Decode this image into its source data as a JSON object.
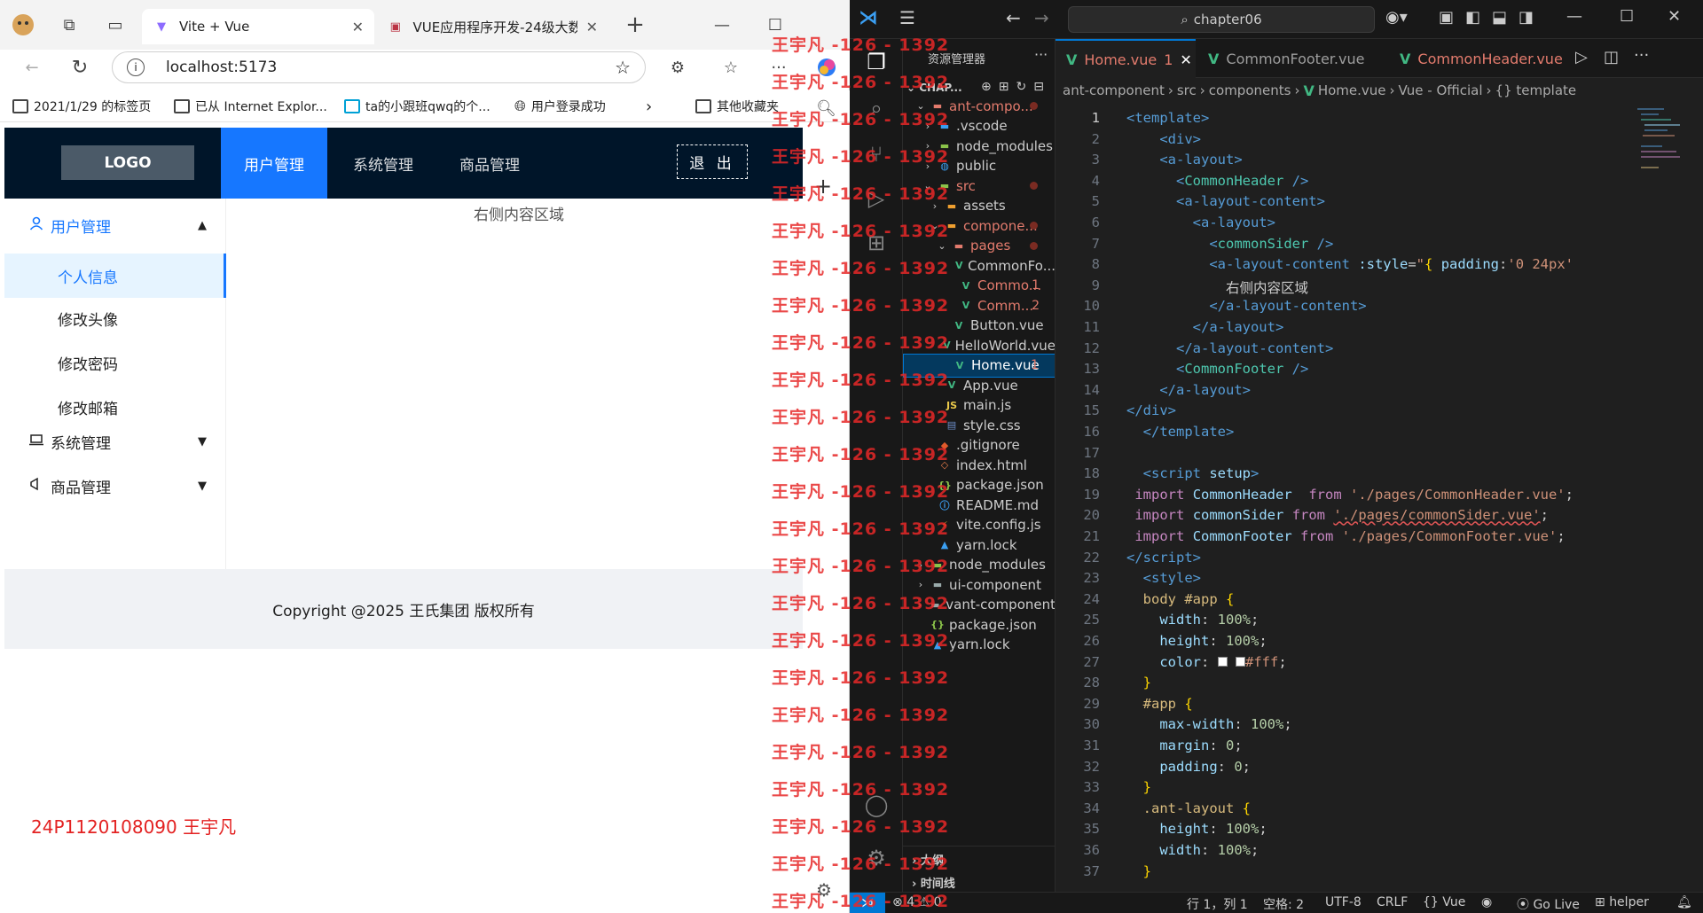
{
  "browser": {
    "tabs": [
      {
        "title": "Vite + Vue"
      },
      {
        "title": "VUE应用程序开发-24级大数"
      }
    ],
    "url": "localhost:5173",
    "bookmarks": [
      "2021/1/29 的标签页",
      "已从 Internet Explor...",
      "ta的小跟班qwq的个...",
      "用户登录成功",
      "其他收藏夹"
    ]
  },
  "app": {
    "logo": "LOGO",
    "nav": [
      "用户管理",
      "系统管理",
      "商品管理"
    ],
    "logout": "退 出",
    "sider": {
      "user_menu": "用户管理",
      "user_items": [
        "个人信息",
        "修改头像",
        "修改密码",
        "修改邮箱"
      ],
      "system_menu": "系统管理",
      "goods_menu": "商品管理"
    },
    "content": "右侧内容区域",
    "footer": "Copyright @2025 王氏集团 版权所有",
    "student_id": "24P1120108090 王宇凡"
  },
  "watermark": "王宇凡 -126 - 1392",
  "vscode": {
    "search": "chapter06",
    "explorer_title": "资源管理器",
    "explorer_root": "CHAP...",
    "tree": [
      {
        "label": "ant-compo...",
        "dot": true
      },
      {
        "label": ".vscode"
      },
      {
        "label": "node_modules"
      },
      {
        "label": "public"
      },
      {
        "label": "src",
        "dot": true
      },
      {
        "label": "assets"
      },
      {
        "label": "compone...",
        "dot": true
      },
      {
        "label": "pages",
        "dot": true
      },
      {
        "label": "CommonFo..."
      },
      {
        "label": "Commo...",
        "num": "1"
      },
      {
        "label": "Comm...",
        "num": "2"
      },
      {
        "label": "Button.vue"
      },
      {
        "label": "HelloWorld.vue"
      },
      {
        "label": "Home.vue",
        "num": "1"
      },
      {
        "label": "App.vue"
      },
      {
        "label": "main.js"
      },
      {
        "label": "style.css"
      },
      {
        "label": ".gitignore"
      },
      {
        "label": "index.html"
      },
      {
        "label": "package.json"
      },
      {
        "label": "README.md"
      },
      {
        "label": "vite.config.js"
      },
      {
        "label": "yarn.lock"
      },
      {
        "label": "node_modules"
      },
      {
        "label": "ui-component"
      },
      {
        "label": "vant-component"
      },
      {
        "label": "package.json"
      },
      {
        "label": "yarn.lock"
      }
    ],
    "outline": "大纲",
    "timeline": "时间线",
    "tabs": [
      {
        "label": "Home.vue",
        "badge": "1"
      },
      {
        "label": "CommonFooter.vue"
      },
      {
        "label": "CommonHeader.vue"
      }
    ],
    "breadcrumb": [
      "ant-component",
      "src",
      "components",
      "Home.vue",
      "Vue - Official",
      "{} template"
    ],
    "status": {
      "problems": "4",
      "warnings": "0",
      "position": "行 1，列 1",
      "spaces": "空格: 2",
      "encoding": "UTF-8",
      "eol": "CRLF",
      "lang": "Vue",
      "golive": "Go Live",
      "helper": "helper"
    }
  }
}
